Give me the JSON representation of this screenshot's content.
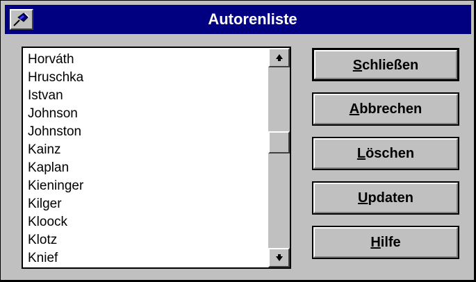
{
  "window": {
    "title": "Autorenliste"
  },
  "list": {
    "items": [
      "Horváth",
      "Hruschka",
      "Istvan",
      "Johnson",
      "Johnston",
      "Kainz",
      "Kaplan",
      "Kieninger",
      "Kilger",
      "Kloock",
      "Klotz",
      "Knief"
    ]
  },
  "buttons": [
    {
      "mnemonic": "S",
      "rest": "chließen"
    },
    {
      "mnemonic": "A",
      "rest": "bbrechen"
    },
    {
      "mnemonic": "L",
      "rest": "öschen"
    },
    {
      "mnemonic": "U",
      "rest": "pdaten"
    },
    {
      "mnemonic": "H",
      "rest": "ilfe"
    }
  ],
  "scrollbar": {
    "up_icon": "arrow-up",
    "down_icon": "arrow-down"
  },
  "colors": {
    "titlebar": "#000080",
    "face": "#c0c0c0"
  }
}
